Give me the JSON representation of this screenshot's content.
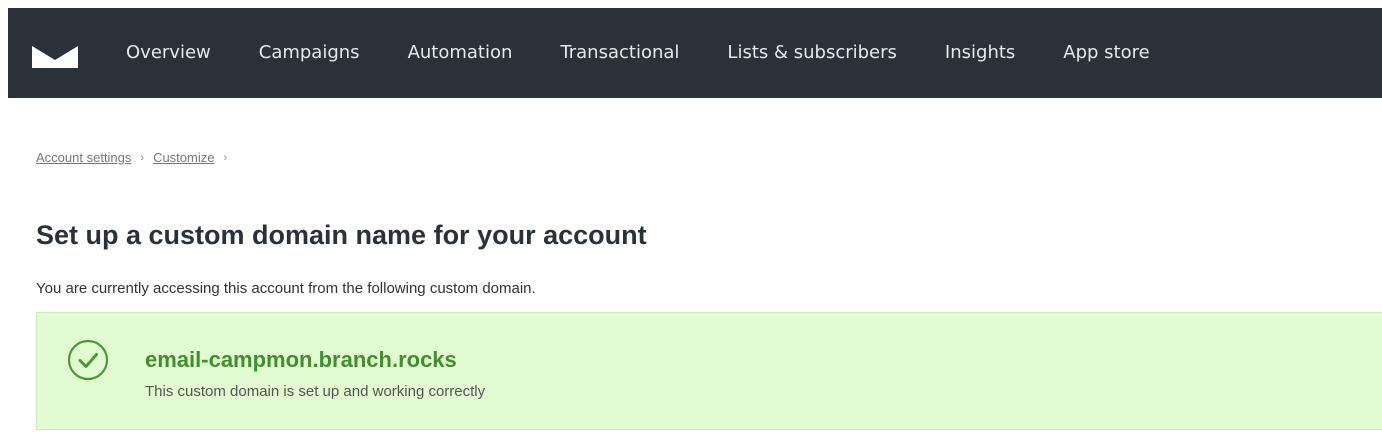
{
  "nav": {
    "logo_icon": "envelope-logo-icon",
    "items": [
      {
        "label": "Overview"
      },
      {
        "label": "Campaigns"
      },
      {
        "label": "Automation"
      },
      {
        "label": "Transactional"
      },
      {
        "label": "Lists & subscribers"
      },
      {
        "label": "Insights"
      },
      {
        "label": "App store"
      }
    ]
  },
  "breadcrumb": {
    "items": [
      {
        "label": "Account settings"
      },
      {
        "label": "Customize"
      }
    ],
    "separator": "›"
  },
  "page": {
    "title": "Set up a custom domain name for your account",
    "intro": "You are currently accessing this account from the following custom domain."
  },
  "domain": {
    "name": "email-campmon.branch.rocks",
    "status": "This custom domain is set up and working correctly",
    "status_icon": "check-circle-icon"
  },
  "colors": {
    "navbar_bg": "#2b3139",
    "success_bg": "#e3fbd1",
    "success_text": "#3f8f2f"
  }
}
